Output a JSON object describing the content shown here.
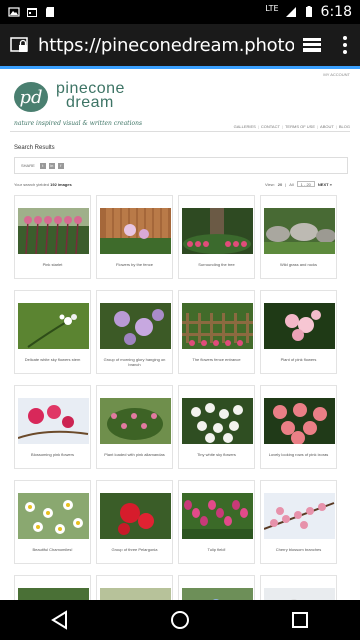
{
  "status_bar": {
    "time": "6:18",
    "network": "LTE",
    "icons": [
      "gallery-icon",
      "calendar-icon",
      "sd-card-icon",
      "signal-icon",
      "battery-icon"
    ]
  },
  "browser": {
    "url": "https://pineconedream.photoshe",
    "load_progress": 1.0,
    "accent": "#3aa0ff"
  },
  "site": {
    "my_account": "MY ACCOUNT",
    "logo_mark": "pd",
    "logo_line1": "pinecone",
    "logo_line2": "dream",
    "tagline": "nature inspired visual & written creations",
    "brand_color": "#3d7465",
    "nav": [
      "GALLERIES",
      "CONTACT",
      "TERMS OF USE",
      "ABOUT",
      "BLOG"
    ]
  },
  "search": {
    "title": "Search Results",
    "share_label": "SHARE",
    "share_icons": [
      "t",
      "in",
      "f"
    ],
    "results_prefix": "Your search yielded",
    "results_count": "192 images",
    "view_label": "View:",
    "view_options": [
      "20",
      "All"
    ],
    "page_select": "1 - 20",
    "next": "NEXT »"
  },
  "results": [
    {
      "caption": "Pink starlet",
      "thumb": "pink-flowers-tall"
    },
    {
      "caption": "Flowers by the fence",
      "thumb": "flowers-fence"
    },
    {
      "caption": "Surrounding the tree",
      "thumb": "tree-flowers"
    },
    {
      "caption": "Wild grass and rocks",
      "thumb": "rocks-grass"
    },
    {
      "caption": "Delicate white sky flowers stem",
      "thumb": "white-sky-flower"
    },
    {
      "caption": "Group of morning glory hanging on branch",
      "thumb": "morning-glory"
    },
    {
      "caption": "The flowers fence entrance",
      "thumb": "fence-entrance"
    },
    {
      "caption": "Plant of pink flowers",
      "thumb": "pink-plant"
    },
    {
      "caption": "Blossoming pink flowers",
      "thumb": "blossom-pink"
    },
    {
      "caption": "Plant loaded with pink allamandas",
      "thumb": "allamanda"
    },
    {
      "caption": "Tiny white sky flowers",
      "thumb": "white-tiny"
    },
    {
      "caption": "Lovely looking rows of pink ixoras",
      "thumb": "ixora"
    },
    {
      "caption": "Beautiful Chamomiles!",
      "thumb": "chamomile"
    },
    {
      "caption": "Group of three Pelargonia",
      "thumb": "pelargonia"
    },
    {
      "caption": "Tulip field!",
      "thumb": "tulips"
    },
    {
      "caption": "Cherry blossom branches",
      "thumb": "cherry"
    },
    {
      "caption": "",
      "thumb": "partial-1"
    },
    {
      "caption": "",
      "thumb": "partial-2"
    },
    {
      "caption": "",
      "thumb": "partial-3"
    },
    {
      "caption": "",
      "thumb": "partial-4"
    }
  ]
}
